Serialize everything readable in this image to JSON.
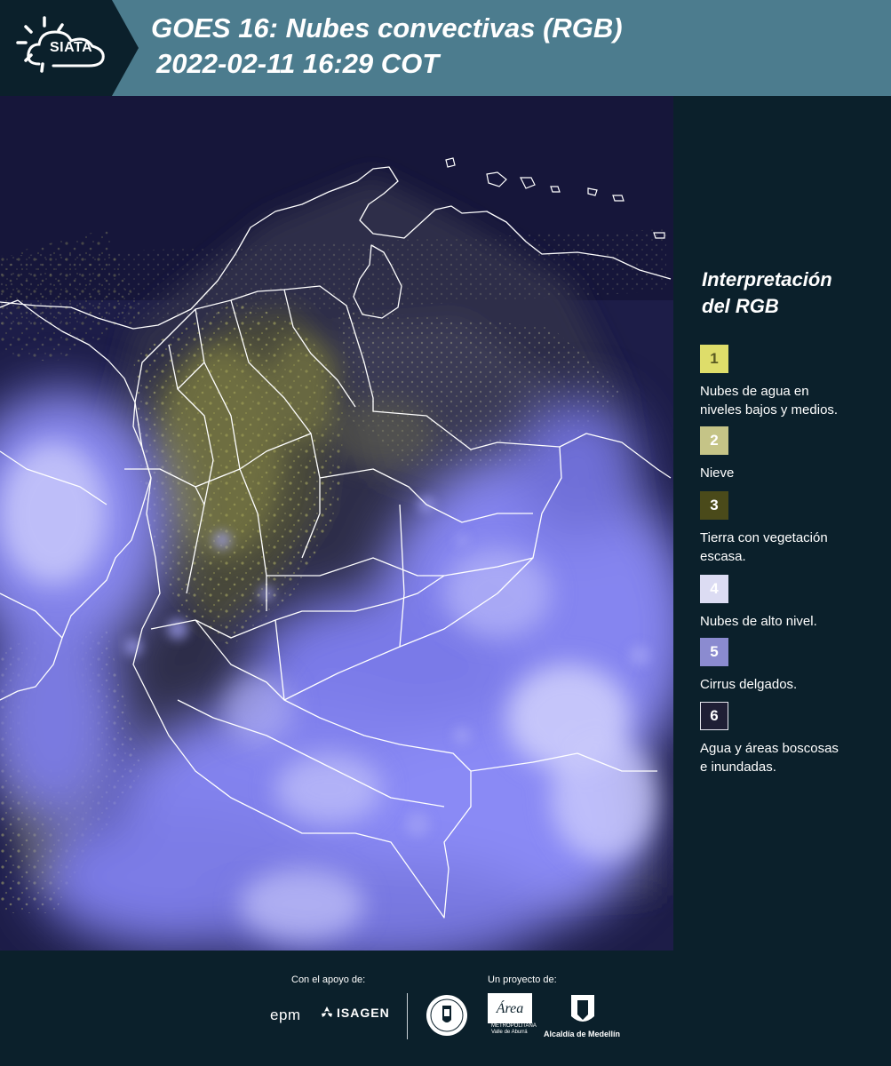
{
  "header": {
    "logo_text": "SIATA",
    "title_line1": "GOES 16: Nubes convectivas (RGB)",
    "title_line2": "2022-02-11 16:29 COT"
  },
  "legend": {
    "title_line1": "Interpretación",
    "title_line2": "del RGB",
    "items": [
      {
        "number": "1",
        "label_line1": "Nubes de agua en",
        "label_line2": "niveles bajos y medios.",
        "color": "#dedd6a"
      },
      {
        "number": "2",
        "label_line1": "Nieve",
        "label_line2": "",
        "color": "#c5c487"
      },
      {
        "number": "3",
        "label_line1": "Tierra con vegetación",
        "label_line2": "escasa.",
        "color": "#4a4a1a"
      },
      {
        "number": "4",
        "label_line1": "Nubes de alto nivel.",
        "label_line2": "",
        "color": "#dcdcf3"
      },
      {
        "number": "5",
        "label_line1": "Cirrus delgados.",
        "label_line2": "",
        "color": "#8b8bd0"
      },
      {
        "number": "6",
        "label_line1": "Agua y áreas boscosas",
        "label_line2": "e inundadas.",
        "color": "#1f1f35"
      }
    ]
  },
  "footer": {
    "support_caption": "Con el apoyo de:",
    "project_caption": "Un proyecto de:",
    "epm": "epm",
    "isagen": "ISAGEN",
    "area_mark": "Área",
    "area_sub1": "METROPOLITANA",
    "area_sub2": "Valle de Aburrá",
    "alcaldia": "Alcaldía de Medellín"
  },
  "colors": {
    "header_bg": "#4c7c8e",
    "page_bg": "#0b202b",
    "map_ocean": "#1f1f4a",
    "cloud_high": "#8c8cf5",
    "cloud_low": "#cfcf6a"
  }
}
